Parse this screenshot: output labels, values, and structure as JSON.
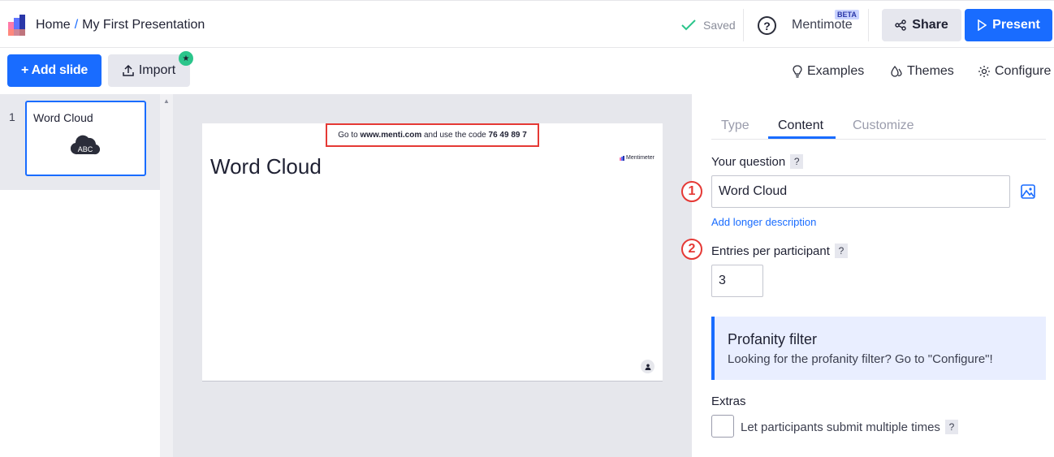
{
  "header": {
    "breadcrumb_home": "Home",
    "breadcrumb_sep": "/",
    "presentation_title": "My First Presentation",
    "saved_status": "Saved",
    "mentimote_label": "Mentimote",
    "beta_badge": "BETA",
    "share_label": "Share",
    "present_label": "Present"
  },
  "toolbar": {
    "add_slide_label": "+ Add slide",
    "import_label": "Import",
    "examples_label": "Examples",
    "themes_label": "Themes",
    "configure_label": "Configure"
  },
  "slides": [
    {
      "number": "1",
      "title": "Word Cloud",
      "icon": "word-cloud-icon",
      "icon_text": "ABC"
    }
  ],
  "canvas": {
    "join_prefix": "Go to ",
    "join_url": "www.menti.com",
    "join_middle": " and use the code ",
    "join_code": "76 49 89 7",
    "slide_title": "Word Cloud",
    "brand_mark": "Mentimeter"
  },
  "panel": {
    "tabs": [
      "Type",
      "Content",
      "Customize"
    ],
    "active_tab": "Content",
    "question_label": "Your question",
    "question_help": "?",
    "question_value": "Word Cloud",
    "add_description_link": "Add longer description",
    "entries_label": "Entries per participant",
    "entries_help": "?",
    "entries_value": "3",
    "profanity_title": "Profanity filter",
    "profanity_text": "Looking for the profanity filter? Go to \"Configure\"!",
    "extras_label": "Extras",
    "multiple_submit_label": "Let participants submit multiple times",
    "multiple_submit_help": "?"
  },
  "annotations": [
    "1",
    "2"
  ],
  "colors": {
    "accent": "#196cff",
    "annotation": "#e53935",
    "saved_check": "#2bc58b"
  }
}
